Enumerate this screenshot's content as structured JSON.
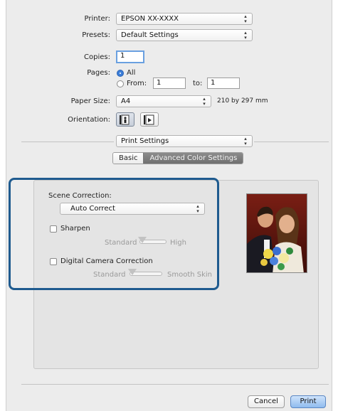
{
  "printer": {
    "label": "Printer:",
    "value": "EPSON XX-XXXX"
  },
  "presets": {
    "label": "Presets:",
    "value": "Default Settings"
  },
  "copies": {
    "label": "Copies:",
    "value": "1"
  },
  "pages": {
    "label": "Pages:",
    "all_label": "All",
    "from_label": "From:",
    "from_value": "1",
    "to_label": "to:",
    "to_value": "1",
    "selected": "All"
  },
  "paper_size": {
    "label": "Paper Size:",
    "value": "A4",
    "dimensions": "210 by 297 mm"
  },
  "orientation": {
    "label": "Orientation:",
    "options": [
      "portrait-icon",
      "landscape-icon"
    ],
    "selected": "portrait"
  },
  "section_popup": {
    "value": "Print Settings"
  },
  "tabs": {
    "items": [
      "Basic",
      "Advanced Color Settings"
    ],
    "selected": "Advanced Color Settings"
  },
  "scene_correction": {
    "label": "Scene Correction:",
    "value": "Auto Correct"
  },
  "sharpen": {
    "label": "Sharpen",
    "checked": false,
    "min_label": "Standard",
    "max_label": "High"
  },
  "digital_camera": {
    "label": "Digital Camera Correction",
    "checked": false,
    "min_label": "Standard",
    "max_label": "Smooth Skin"
  },
  "buttons": {
    "cancel": "Cancel",
    "print": "Print"
  },
  "colors": {
    "highlight": "#1f5b8f",
    "default_button": "#8fbbee",
    "selected_tab": "#7a7a7a"
  }
}
